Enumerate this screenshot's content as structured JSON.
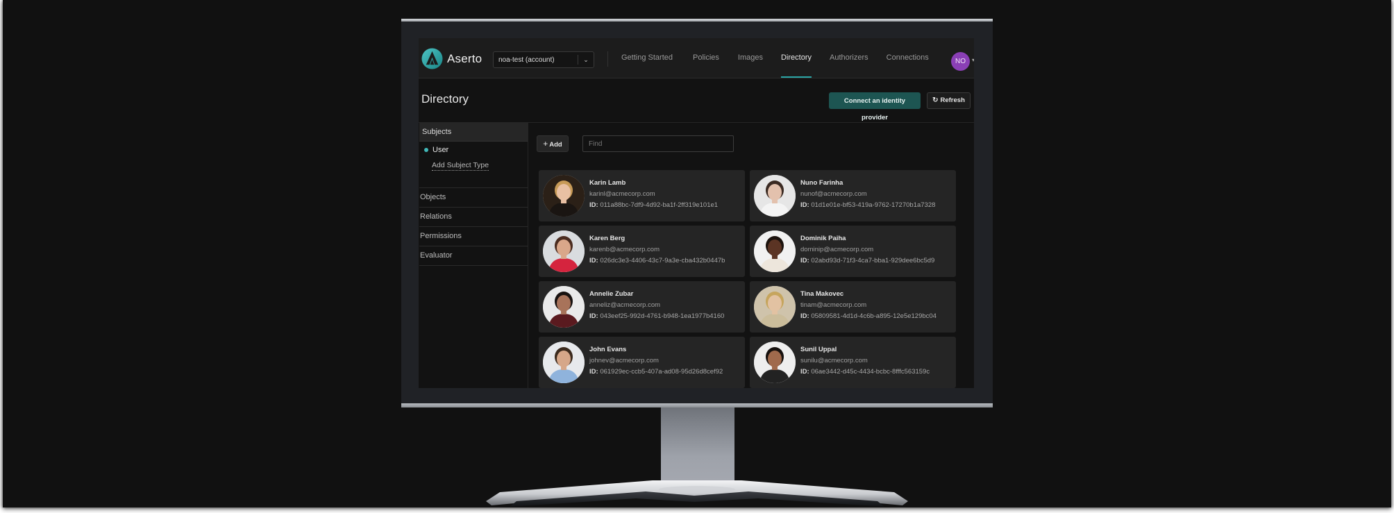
{
  "app": {
    "brand": "Aserto",
    "account_select": {
      "value": "noa-test (account)"
    },
    "nav": [
      {
        "label": "Getting Started",
        "active": false
      },
      {
        "label": "Policies",
        "active": false
      },
      {
        "label": "Images",
        "active": false
      },
      {
        "label": "Directory",
        "active": true
      },
      {
        "label": "Authorizers",
        "active": false
      },
      {
        "label": "Connections",
        "active": false
      }
    ],
    "user_avatar": {
      "initials": "NO",
      "color": "#8a3fb5"
    },
    "accent_color": "#2aa6a6"
  },
  "page": {
    "title": "Directory",
    "connect_button": "Connect an identity provider",
    "refresh_button": "Refresh"
  },
  "sidebar": {
    "subjects_header": "Subjects",
    "subject_types": [
      {
        "label": "User"
      }
    ],
    "add_subject_type": "Add Subject Type",
    "sections": [
      {
        "label": "Objects"
      },
      {
        "label": "Relations"
      },
      {
        "label": "Permissions"
      },
      {
        "label": "Evaluator"
      }
    ]
  },
  "toolbar": {
    "add_label": "Add",
    "find_placeholder": "Find",
    "find_value": ""
  },
  "users": [
    {
      "name": "Karin Lamb",
      "email": "karinl@acmecorp.com",
      "id_label": "ID:",
      "id": "011a88bc-7df9-4d92-ba1f-2ff319e101e1",
      "photo": {
        "bg": "#2b2017",
        "hair": "#c79a57",
        "skin": "#e8c0a3",
        "shirt": "#1a1512"
      }
    },
    {
      "name": "Nuno Farinha",
      "email": "nunof@acmecorp.com",
      "id_label": "ID:",
      "id": "01d1e01e-bf53-419a-9762-17270b1a7328",
      "photo": {
        "bg": "#e6e6e6",
        "hair": "#3a2a22",
        "skin": "#e3c1ad",
        "shirt": "#f4f4f4"
      }
    },
    {
      "name": "Karen Berg",
      "email": "karenb@acmecorp.com",
      "id_label": "ID:",
      "id": "026dc3e3-4406-43c7-9a3e-cba432b0447b",
      "photo": {
        "bg": "#d9dcdf",
        "hair": "#4a2c20",
        "skin": "#d9a78a",
        "shirt": "#d5243e"
      }
    },
    {
      "name": "Dominik Paiha",
      "email": "dominip@acmecorp.com",
      "id_label": "ID:",
      "id": "02abd93d-71f3-4ca7-bba1-929dee6bc5d9",
      "photo": {
        "bg": "#f1f1f1",
        "hair": "#1b120d",
        "skin": "#5b3424",
        "shirt": "#ede6dc"
      }
    },
    {
      "name": "Annelie Zubar",
      "email": "anneliz@acmecorp.com",
      "id_label": "ID:",
      "id": "043eef25-992d-4761-b948-1ea1977b4160",
      "photo": {
        "bg": "#e9e9e9",
        "hair": "#17110f",
        "skin": "#a8735a",
        "shirt": "#5a1a1f"
      }
    },
    {
      "name": "Tina Makovec",
      "email": "tinam@acmecorp.com",
      "id_label": "ID:",
      "id": "05809581-4d1d-4c6b-a895-12e5e129bc04",
      "photo": {
        "bg": "#cfc3ab",
        "hair": "#c6a55d",
        "skin": "#e2c2a2",
        "shirt": "#cbbd9b"
      }
    },
    {
      "name": "John Evans",
      "email": "johnev@acmecorp.com",
      "id_label": "ID:",
      "id": "061929ec-ccb5-407a-ad08-95d26d8cef92",
      "photo": {
        "bg": "#e7e9ec",
        "hair": "#3b2a1d",
        "skin": "#d6a789",
        "shirt": "#8fb3dc"
      }
    },
    {
      "name": "Sunil Uppal",
      "email": "sunilu@acmecorp.com",
      "id_label": "ID:",
      "id": "06ae3442-d45c-4434-bcbc-8fffc563159c",
      "photo": {
        "bg": "#eeeeee",
        "hair": "#16110e",
        "skin": "#a06a4c",
        "shirt": "#222222"
      }
    }
  ]
}
